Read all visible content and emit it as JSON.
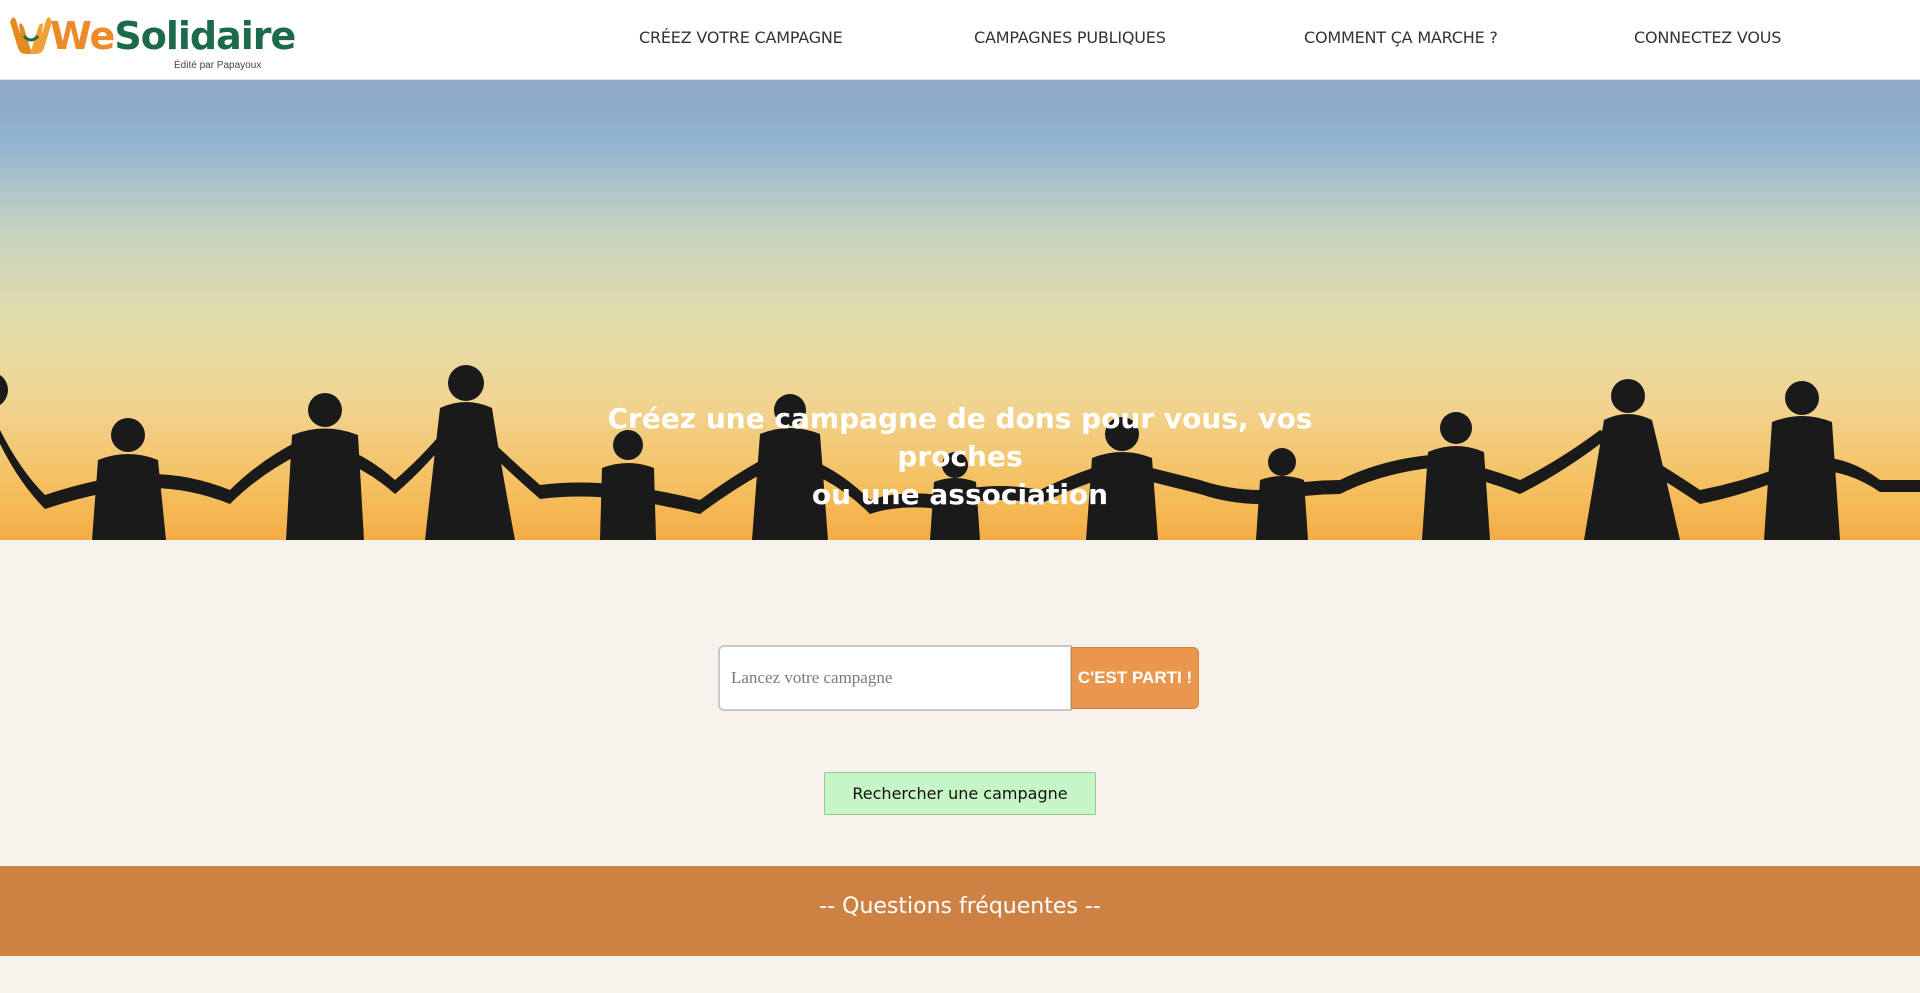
{
  "brand": {
    "name_first": "We",
    "name_rest": "Solidaire",
    "tagline": "Édité par Papayoux",
    "green": "#1d6a4a",
    "orange": "#ef8a2b"
  },
  "nav": {
    "items": [
      {
        "label": "CRÉEZ VOTRE CAMPAGNE"
      },
      {
        "label": "CAMPAGNES PUBLIQUES"
      },
      {
        "label": "COMMENT ÇA MARCHE ?"
      },
      {
        "label": "CONNECTEZ VOUS"
      }
    ]
  },
  "hero": {
    "title_line1": "Créez une campagne de dons pour vous, vos proches",
    "title_line2": "ou une association"
  },
  "campaign_form": {
    "placeholder": "Lancez votre campagne",
    "value": "",
    "submit_label": "C'EST PARTI !"
  },
  "search": {
    "button_label": "Rechercher une campagne"
  },
  "faq": {
    "title": "-- Questions fréquentes --"
  },
  "colors": {
    "accent_orange": "#e9964f",
    "faq_band": "#cd8244",
    "search_green": "#c7f5c5",
    "page_bg": "#f7f2eb"
  }
}
